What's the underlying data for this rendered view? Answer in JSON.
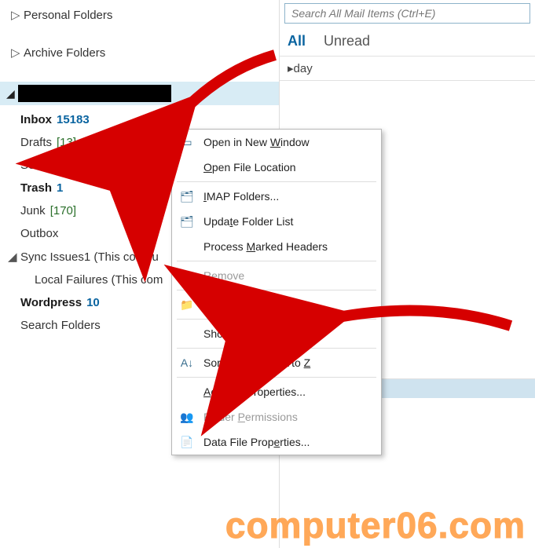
{
  "nav": {
    "favorites_label": "",
    "personal_folders_label": "Personal Folders",
    "archive_folders_label": "Archive Folders"
  },
  "folders": {
    "inbox": {
      "name": "Inbox",
      "count": "15183"
    },
    "drafts": {
      "name": "Drafts",
      "count": "[13]"
    },
    "sent": {
      "name": "Sent"
    },
    "trash": {
      "name": "Trash",
      "count": "1"
    },
    "junk": {
      "name": "Junk",
      "count": "[170]"
    },
    "outbox": {
      "name": "Outbox"
    },
    "sync": {
      "name": "Sync Issues1 (This compu"
    },
    "local_failures": {
      "name": "Local Failures (This com"
    },
    "wordpress": {
      "name": "Wordpress",
      "count": "10"
    },
    "search_folders": {
      "name": "Search Folders"
    }
  },
  "search": {
    "placeholder": "Search All Mail Items (Ctrl+E)"
  },
  "filters": {
    "all": "All",
    "unread": "Unread"
  },
  "group": {
    "today": "▸day"
  },
  "ctx": {
    "open_window": "Open in New Window",
    "open_location": "Open File Location",
    "imap": "IMAP Folders...",
    "update": "Update Folder List",
    "process": "Process Marked Headers",
    "remove": "Remove",
    "new_folder": "New Folder...",
    "favorites": "Show in Favorites",
    "sort": "Sort Subfolders A to Z",
    "acct": "Account Properties...",
    "perm": "Folder Permissions",
    "datafile": "Data File Properties..."
  },
  "watermark": "computer06.com"
}
